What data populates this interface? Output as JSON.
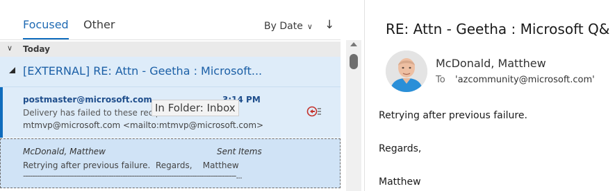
{
  "tabs": {
    "focused": "Focused",
    "other": "Other"
  },
  "sort": {
    "label": "By Date",
    "chevron_icon": "chevron-down-icon",
    "direction_icon": "arrow-down-icon"
  },
  "group": {
    "label": "Today"
  },
  "conversation": {
    "subject": "[EXTERNAL] RE: Attn - Geetha : Microsoft..."
  },
  "messages": [
    {
      "sender": "postmaster@microsoft.com",
      "time": "3:14 PM",
      "preview_line1": "Delivery has failed to these recipients",
      "preview_line2": "mtmvp@microsoft.com <mailto:mtmvp@microsoft.com>",
      "status_icon": "undeliverable-icon"
    },
    {
      "sender": "McDonald, Matthew",
      "folder": "Sent Items",
      "preview_line1": "Retrying after previous failure.  Regards,    Matthew",
      "preview_line2": "--------------------------------------------------------------------------------------------..."
    }
  ],
  "tooltip": "In Folder: Inbox",
  "reading": {
    "subject": "RE: Attn - Geetha : Microsoft Q&",
    "from": "McDonald, Matthew",
    "to_label": "To",
    "to_value": "'azcommunity@microsoft.com'",
    "body": [
      "Retrying after previous failure.",
      "Regards,",
      "Matthew"
    ]
  },
  "colors": {
    "accent": "#0f6cbd",
    "selected_bg": "#deecf9"
  }
}
